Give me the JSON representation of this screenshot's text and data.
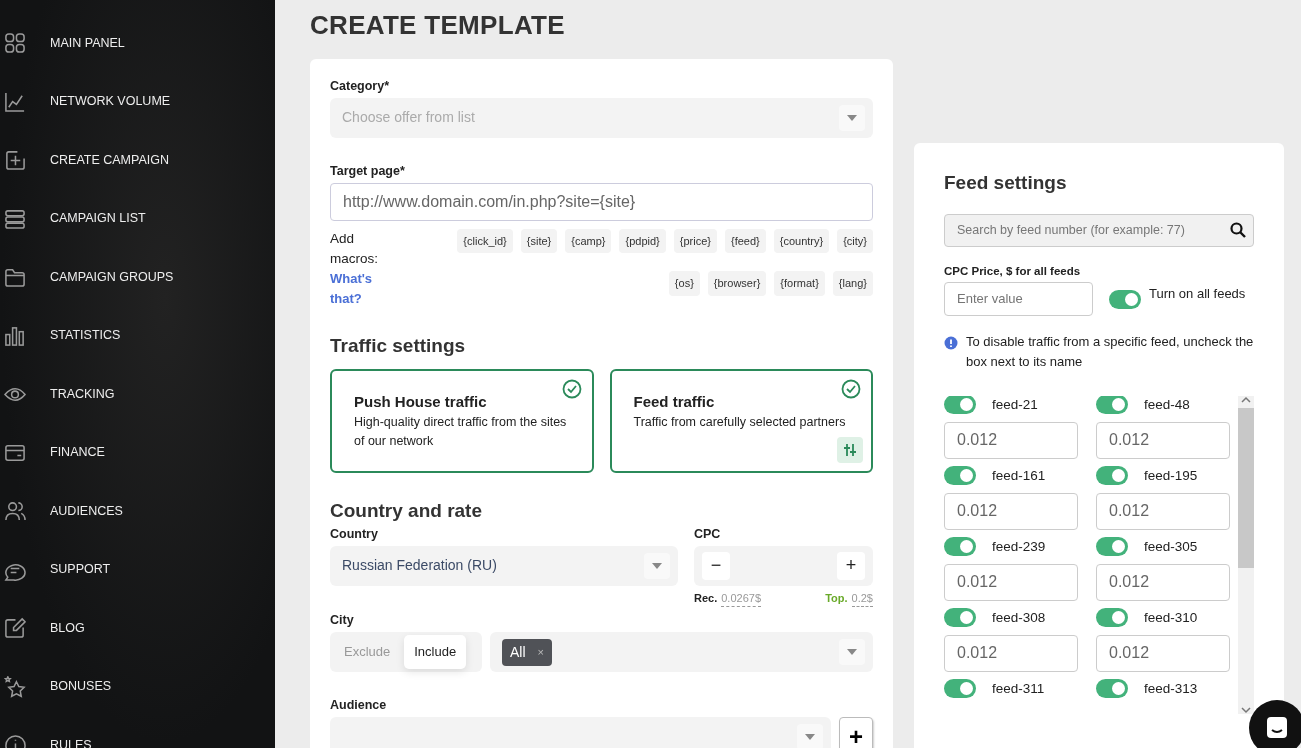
{
  "sidebar": {
    "items": [
      {
        "label": "MAIN PANEL",
        "kind": "grid"
      },
      {
        "label": "NETWORK VOLUME",
        "kind": "chart"
      },
      {
        "label": "CREATE CAMPAIGN",
        "kind": "plus"
      },
      {
        "label": "CAMPAIGN LIST",
        "kind": "list"
      },
      {
        "label": "CAMPAIGN GROUPS",
        "kind": "folder"
      },
      {
        "label": "STATISTICS",
        "kind": "bars"
      },
      {
        "label": "TRACKING",
        "kind": "eye"
      },
      {
        "label": "FINANCE",
        "kind": "card"
      },
      {
        "label": "AUDIENCES",
        "kind": "people"
      },
      {
        "label": "SUPPORT",
        "kind": "chat"
      },
      {
        "label": "BLOG",
        "kind": "edit"
      },
      {
        "label": "BONUSES",
        "kind": "star"
      },
      {
        "label": "RULES",
        "kind": "info"
      }
    ]
  },
  "page_title": "CREATE TEMPLATE",
  "form": {
    "category": {
      "label": "Category*",
      "placeholder": "Choose offer from list"
    },
    "target_page": {
      "label": "Target page*",
      "placeholder": "http://www.domain.com/in.php?site={site}"
    },
    "macros": {
      "label": "Add macros:",
      "link": "What's that?",
      "chips": [
        "{click_id}",
        "{site}",
        "{camp}",
        "{pdpid}",
        "{price}",
        "{feed}",
        "{country}",
        "{city}",
        "{os}",
        "{browser}",
        "{format}",
        "{lang}"
      ]
    },
    "traffic_heading": "Traffic settings",
    "traffic_options": [
      {
        "title": "Push House traffic",
        "description": "High-quality direct traffic from the sites of our network",
        "selected": true,
        "settings": false
      },
      {
        "title": "Feed traffic",
        "description": "Traffic from carefully selected partners",
        "selected": true,
        "settings": true
      }
    ],
    "country_heading": "Country and rate",
    "country": {
      "label": "Country",
      "value": "Russian Federation (RU)"
    },
    "cpc": {
      "label": "CPC",
      "minus": "−",
      "plus": "+",
      "rec_label": "Rec.",
      "rec_value": "0.0267$",
      "top_label": "Top.",
      "top_value": "0.2$"
    },
    "city": {
      "label": "City",
      "modes": [
        {
          "label": "Exclude",
          "selected": false
        },
        {
          "label": "Include",
          "selected": true
        }
      ],
      "tags": [
        "All"
      ],
      "tag_remove": "×"
    },
    "audience": {
      "label": "Audience",
      "add": "+"
    }
  },
  "feed_settings": {
    "title": "Feed settings",
    "search": {
      "placeholder": "Search by feed number (for example: 77)"
    },
    "cpc_label": "CPC Price, $ for all feeds",
    "cpc_placeholder": "Enter value",
    "all_feeds": {
      "label": "Turn on all feeds",
      "on": true
    },
    "info": "To disable traffic from a specific feed, uncheck the box next to its name",
    "feeds": [
      {
        "name": "feed-21",
        "on": true,
        "placeholder": "0.012"
      },
      {
        "name": "feed-48",
        "on": true,
        "placeholder": "0.012"
      },
      {
        "name": "feed-161",
        "on": true,
        "placeholder": "0.012"
      },
      {
        "name": "feed-195",
        "on": true,
        "placeholder": "0.012"
      },
      {
        "name": "feed-239",
        "on": true,
        "placeholder": "0.012"
      },
      {
        "name": "feed-305",
        "on": true,
        "placeholder": "0.012"
      },
      {
        "name": "feed-308",
        "on": true,
        "placeholder": "0.012"
      },
      {
        "name": "feed-310",
        "on": true,
        "placeholder": "0.012"
      },
      {
        "name": "feed-311",
        "on": true
      },
      {
        "name": "feed-313",
        "on": true
      }
    ]
  }
}
